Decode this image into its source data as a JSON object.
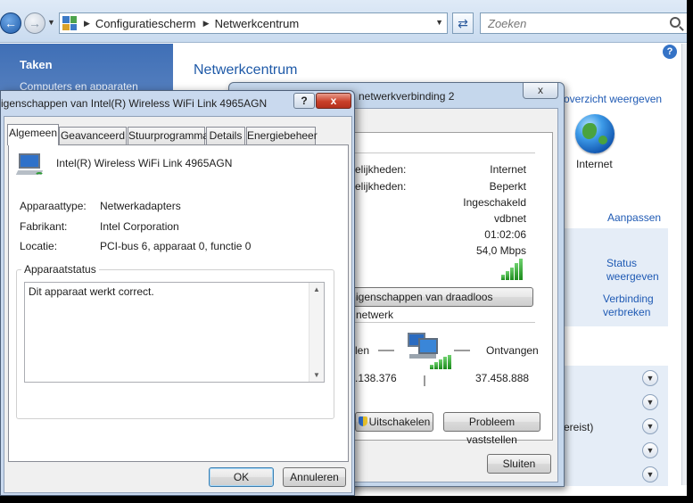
{
  "explorer": {
    "breadcrumb": [
      "Configuratiescherm",
      "Netwerkcentrum"
    ],
    "search_placeholder": "Zoeken",
    "sidebar": {
      "title": "Taken",
      "link": "Computers en apparaten"
    },
    "page_title": "Netwerkcentrum",
    "overview_link": "overzicht weergeven",
    "internet_label": "Internet",
    "customize_link": "Aanpassen",
    "status_link": "Status weergeven",
    "disconnect_link": "Verbinding verbreken",
    "partial_text": "ereist)"
  },
  "status_dialog": {
    "title": "netwerkverbinding 2",
    "rows": [
      {
        "label": "elijkheden:",
        "value": "Internet"
      },
      {
        "label": "elijkheden:",
        "value": "Beperkt"
      },
      {
        "label": "",
        "value": "Ingeschakeld"
      },
      {
        "label": "",
        "value": "vdbnet"
      },
      {
        "label": "",
        "value": "01:02:06"
      },
      {
        "label": "",
        "value": "54,0 Mbps"
      }
    ],
    "wireless_props_button": "igenschappen van draadloos netwerk",
    "sent_label": "len",
    "received_label": "Ontvangen",
    "sent_value": ".138.376",
    "received_value": "37.458.888",
    "disable_button": "Uitschakelen",
    "diagnose_button": "Probleem vaststellen",
    "close_button": "Sluiten"
  },
  "properties_dialog": {
    "title": "igenschappen van Intel(R) Wireless WiFi Link 4965AGN",
    "help_button": "?",
    "close_button": "x",
    "tabs": [
      "Algemeen",
      "Geavanceerd",
      "Stuurprogramma",
      "Details",
      "Energiebeheer"
    ],
    "device_name": "Intel(R) Wireless WiFi Link 4965AGN",
    "properties": [
      {
        "label": "Apparaattype:",
        "value": "Netwerkadapters"
      },
      {
        "label": "Fabrikant:",
        "value": "Intel Corporation"
      },
      {
        "label": "Locatie:",
        "value": "PCI-bus 6, apparaat 0, functie 0"
      }
    ],
    "status_group_label": "Apparaatstatus",
    "status_text": "Dit apparaat werkt correct.",
    "ok_button": "OK",
    "cancel_button": "Annuleren"
  },
  "colors": {
    "link": "#1f5ab4",
    "accent": "#1f5aa8",
    "signal": "#2e9b35"
  }
}
